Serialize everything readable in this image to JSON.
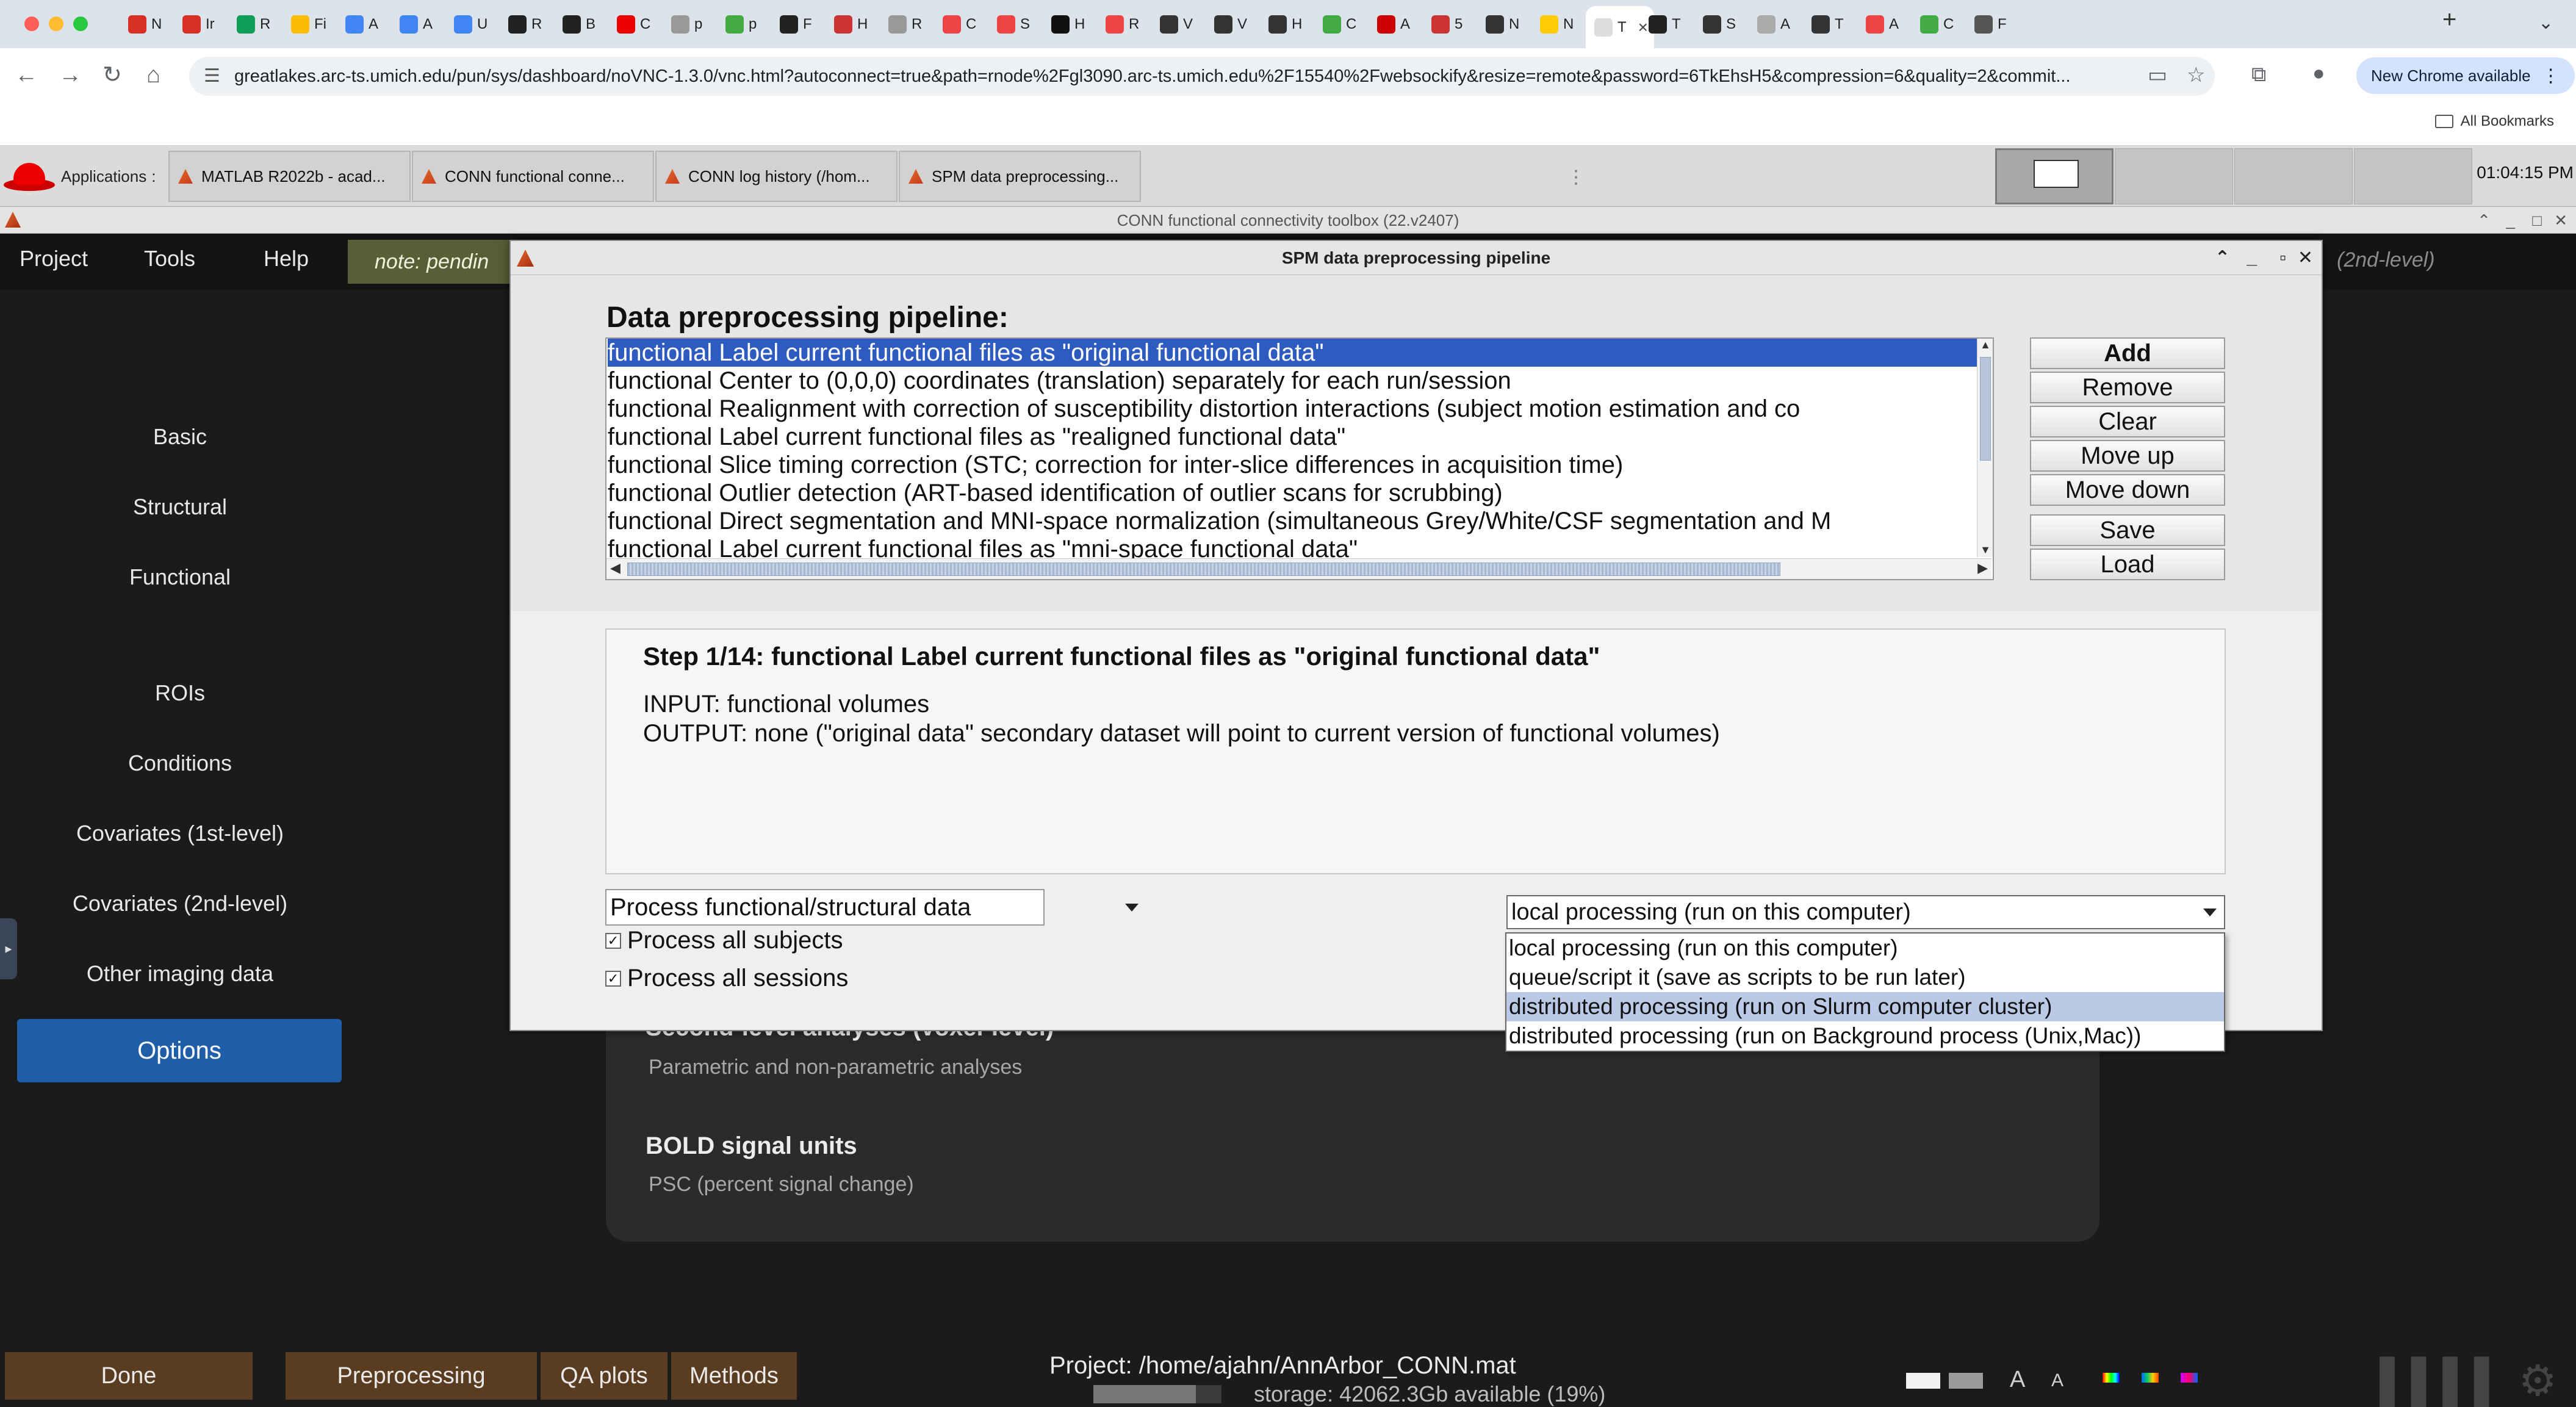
{
  "browser": {
    "tabs": [
      {
        "label": "N",
        "fav": "#d93025"
      },
      {
        "label": "Ir",
        "fav": "#d93025"
      },
      {
        "label": "R",
        "fav": "#0f9d58"
      },
      {
        "label": "Fi",
        "fav": "#fbbc04"
      },
      {
        "label": "A",
        "fav": "#4285f4"
      },
      {
        "label": "A",
        "fav": "#4285f4"
      },
      {
        "label": "U",
        "fav": "#4285f4"
      },
      {
        "label": "R",
        "fav": "#222"
      },
      {
        "label": "B",
        "fav": "#222"
      },
      {
        "label": "C",
        "fav": "#e00"
      },
      {
        "label": "p",
        "fav": "#999"
      },
      {
        "label": "p",
        "fav": "#4a4"
      },
      {
        "label": "F",
        "fav": "#222"
      },
      {
        "label": "H",
        "fav": "#c33"
      },
      {
        "label": "R",
        "fav": "#999"
      },
      {
        "label": "C",
        "fav": "#e44"
      },
      {
        "label": "S",
        "fav": "#e44"
      },
      {
        "label": "H",
        "fav": "#111"
      },
      {
        "label": "R",
        "fav": "#e44"
      },
      {
        "label": "V",
        "fav": "#333"
      },
      {
        "label": "V",
        "fav": "#333"
      },
      {
        "label": "H",
        "fav": "#333"
      },
      {
        "label": "C",
        "fav": "#4a4"
      },
      {
        "label": "A",
        "fav": "#c00"
      },
      {
        "label": "5",
        "fav": "#c33"
      },
      {
        "label": "N",
        "fav": "#333"
      },
      {
        "label": "N",
        "fav": "#ffcb05"
      },
      {
        "label": "T",
        "fav": "#ddd"
      },
      {
        "label": "T",
        "fav": "#222"
      },
      {
        "label": "S",
        "fav": "#333"
      },
      {
        "label": "A",
        "fav": "#aaa"
      },
      {
        "label": "T",
        "fav": "#333"
      },
      {
        "label": "A",
        "fav": "#e44"
      },
      {
        "label": "C",
        "fav": "#4a4"
      },
      {
        "label": "F",
        "fav": "#555"
      }
    ],
    "active_tab_index": 27,
    "url": "greatlakes.arc-ts.umich.edu/pun/sys/dashboard/noVNC-1.3.0/vnc.html?autoconnect=true&path=rnode%2Fgl3090.arc-ts.umich.edu%2F15540%2Fwebsockify&resize=remote&password=6TkEhsH5&compression=6&quality=2&commit...",
    "new_chrome": "New Chrome available",
    "all_bookmarks": "All Bookmarks"
  },
  "vnc": {
    "applications": "Applications",
    "tasks": [
      "MATLAB R2022b - acad...",
      "CONN functional conne...",
      "CONN log history (/hom...",
      "SPM data preprocessing..."
    ],
    "clock": "01:04:15 PM"
  },
  "conn": {
    "title": "CONN functional connectivity toolbox (22.v2407)",
    "menu": [
      "Project",
      "Tools",
      "Help"
    ],
    "note": "note: pendin",
    "tail": "(2nd-level)",
    "sidebar": [
      "Basic",
      "Structural",
      "Functional",
      "ROIs",
      "Conditions",
      "Covariates (1st-level)",
      "Covariates (2nd-level)",
      "Other imaging data"
    ],
    "options": "Options",
    "bg_sections": [
      {
        "title": "Second-level analyses (voxel-level)",
        "sub": "Parametric and non-parametric analyses"
      },
      {
        "title": "BOLD signal units",
        "sub": "PSC (percent signal change)"
      }
    ],
    "bottom": {
      "done": "Done",
      "preprocessing": "Preprocessing",
      "qa": "QA plots",
      "methods": "Methods"
    },
    "project": "Project: /home/ajahn/AnnArbor_CONN.mat",
    "storage": "storage: 42062.3Gb available (19%)"
  },
  "dialog": {
    "title": "SPM data preprocessing pipeline",
    "heading": "Data preprocessing pipeline:",
    "steps": [
      "functional Label current functional files as \"original functional data\"",
      "functional Center to (0,0,0) coordinates (translation) separately for each run/session",
      "functional Realignment with correction of susceptibility distortion interactions (subject motion estimation and co",
      "functional Label current functional files as \"realigned functional data\"",
      "functional Slice timing correction (STC; correction for inter-slice differences in acquisition time)",
      "functional Outlier detection (ART-based identification of outlier scans for scrubbing)",
      "functional Direct segmentation and MNI-space normalization (simultaneous Grey/White/CSF segmentation and M",
      "functional Label current functional files as \"mni-space functional data\""
    ],
    "buttons": {
      "add": "Add",
      "remove": "Remove",
      "clear": "Clear",
      "moveup": "Move up",
      "movedown": "Move down",
      "save": "Save",
      "load": "Load"
    },
    "step_title": "Step 1/14: functional Label current functional files as \"original functional data\"",
    "step_input": "INPUT: functional volumes",
    "step_output": "OUTPUT: none (\"original data\" secondary dataset will point to current version of functional volumes)",
    "process_select": "Process functional/structural data",
    "all_subjects": "Process all subjects",
    "all_sessions": "Process all sessions",
    "run_select": "local processing (run on this computer)",
    "run_options": [
      "local processing (run on this computer)",
      "queue/script it (save as scripts to be run later)",
      "distributed processing (run on Slurm computer cluster)",
      "distributed processing (run on Background process (Unix,Mac))"
    ],
    "highlighted_option": 2
  }
}
